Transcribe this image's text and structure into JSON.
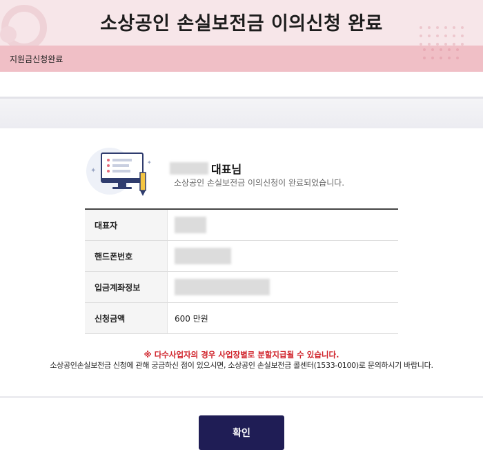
{
  "header": {
    "title": "소상공인 손실보전금 이의신청 완료"
  },
  "breadcrumb": {
    "label": "지원금신청완료"
  },
  "greeting": {
    "name_suffix": "대표님",
    "message": "소상공인 손실보전금 이의신청이 완료되었습니다."
  },
  "table": {
    "rows": [
      {
        "label": "대표자",
        "value": ""
      },
      {
        "label": "핸드폰번호",
        "value": ""
      },
      {
        "label": "입금계좌정보",
        "value": ""
      },
      {
        "label": "신청금액",
        "value": "600 만원"
      }
    ]
  },
  "notice": {
    "warning": "※ 다수사업자의 경우 사업장별로 분할지급될 수 있습니다.",
    "contact": "소상공인손실보전금 신청에 관해 궁금하신 점이 있으시면, 소상공인 손실보전금 콜센터(1533-0100)로 문의하시기 바랍니다."
  },
  "actions": {
    "confirm_label": "확인"
  },
  "colors": {
    "header_bg": "#f7e6e9",
    "subbar_bg": "#f0bfc6",
    "button_bg": "#1f1d55",
    "warning_text": "#d0232b"
  }
}
